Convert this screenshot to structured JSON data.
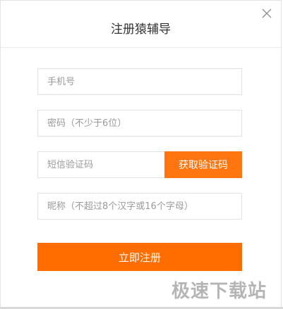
{
  "dialog": {
    "title": "注册猿辅导"
  },
  "form": {
    "phone_placeholder": "手机号",
    "password_placeholder": "密码（不少于6位）",
    "sms_placeholder": "短信验证码",
    "sms_button_label": "获取验证码",
    "nickname_placeholder": "昵称（不超过8个汉字或16个字母）",
    "submit_label": "立即注册"
  },
  "watermark": "极速下载站",
  "colors": {
    "accent": "#ff6d00"
  }
}
